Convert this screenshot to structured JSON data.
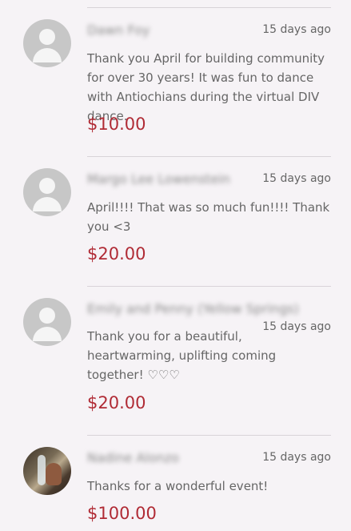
{
  "donations": [
    {
      "name": "Dawn Foy",
      "date": "15 days ago",
      "message": "Thank you April for building community for over 30 years! It was fun to dance with Antiochians during the virtual DIV dance.",
      "amount": "$10.00",
      "avatar": "default-user-icon"
    },
    {
      "name": "Margo Lee Lowenstein",
      "date": "15 days ago",
      "message": "April!!!! That was so much fun!!!! Thank you <3",
      "amount": "$20.00",
      "avatar": "default-user-icon"
    },
    {
      "name": "Emily and Penny (Yellow Springs)",
      "date": "15 days ago",
      "message": "Thank you for a beautiful, heartwarming, uplifting coming together! ♡♡♡",
      "amount": "$20.00",
      "avatar": "default-user-icon"
    },
    {
      "name": "Nadine Alonzo",
      "date": "15 days ago",
      "message": "Thanks for a wonderful event!",
      "amount": "$100.00",
      "avatar": "profile-photo"
    }
  ],
  "colors": {
    "background": "#f6f3f6",
    "amount": "#b02b35",
    "divider": "#d8d3d8"
  }
}
